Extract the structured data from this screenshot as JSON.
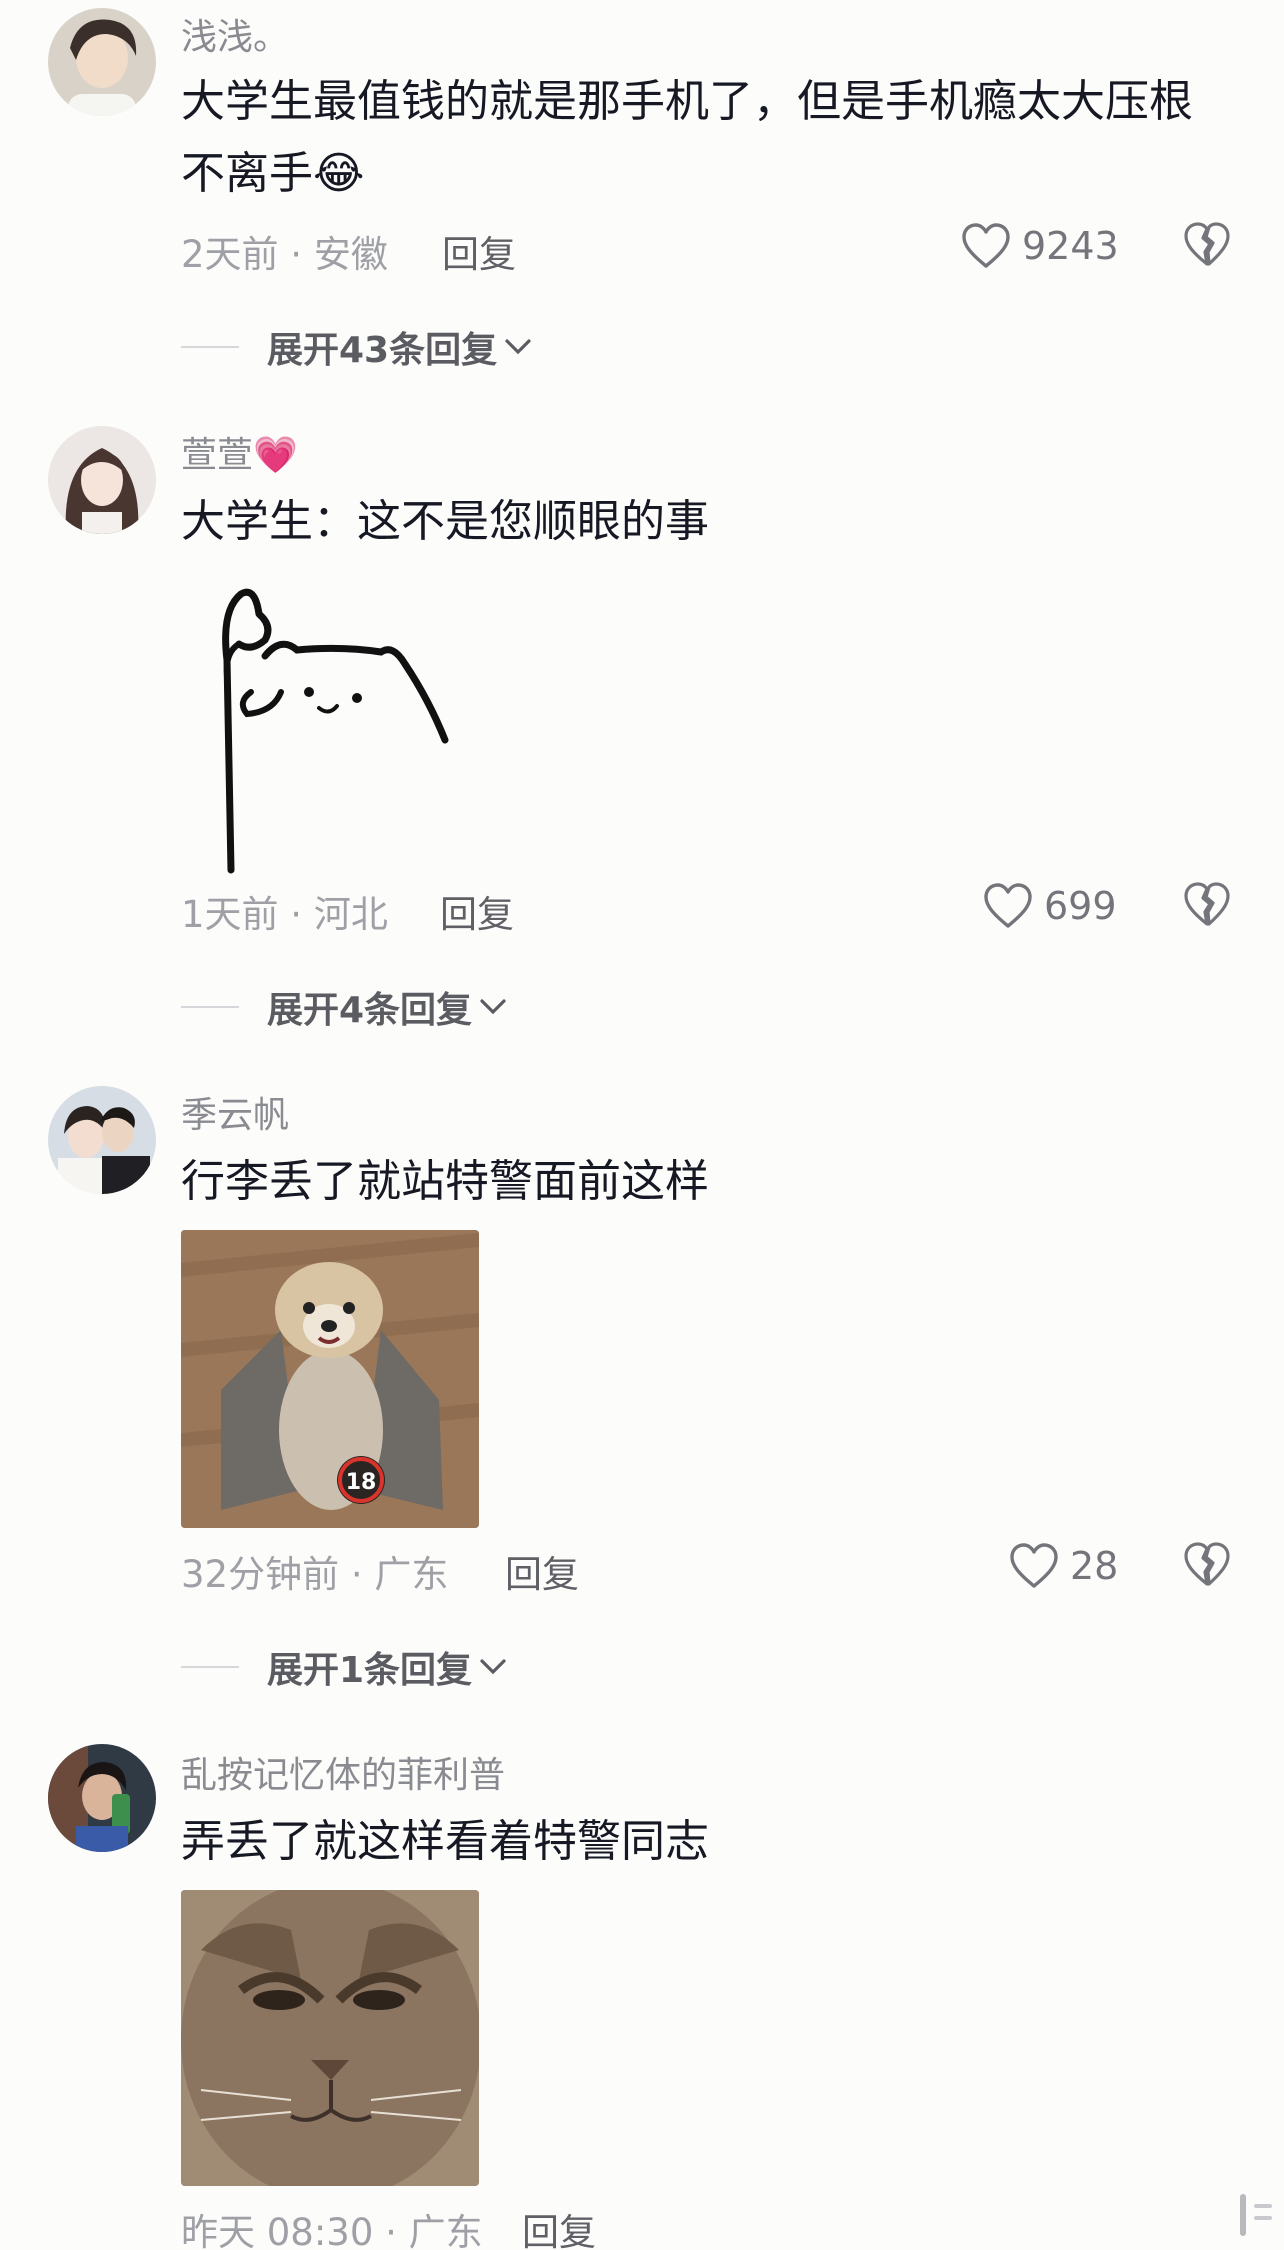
{
  "comments": [
    {
      "username": "浅浅。",
      "text": "大学生最值钱的就是那手机了，但是手机瘾太大压根不离手😂",
      "time_location": "2天前 · 安徽",
      "reply_label": "回复",
      "likes": "9243",
      "expand_label": "展开43条回复"
    },
    {
      "username": "萱萱💗",
      "text": "大学生：这不是您顺眼的事",
      "time_location": "1天前 · 河北",
      "reply_label": "回复",
      "likes": "699",
      "expand_label": "展开4条回复"
    },
    {
      "username": "季云帆",
      "text": "行李丢了就站特警面前这样",
      "badge": "18",
      "time_location": "32分钟前 · 广东",
      "reply_label": "回复",
      "likes": "28",
      "expand_label": "展开1条回复"
    },
    {
      "username": "乱按记忆体的菲利普",
      "text": "弄丢了就这样看着特警同志",
      "time_location": "昨天 08:30 · 广东",
      "reply_label": "回复"
    }
  ],
  "icons": {
    "like": "heart-outline-icon",
    "dislike": "broken-heart-icon",
    "expand": "chevron-down-icon"
  },
  "colors": {
    "background": "#fcfcfb",
    "username": "#8a8b91",
    "meta": "#9fa0a6",
    "text": "#161823"
  }
}
